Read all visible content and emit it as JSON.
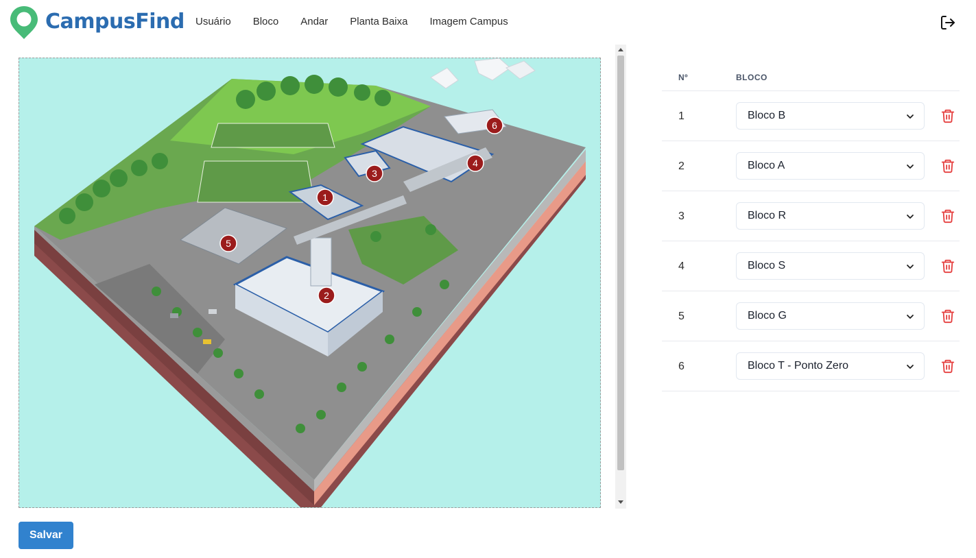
{
  "app": {
    "name": "CampusFind"
  },
  "nav": {
    "items": [
      {
        "label": "Usuário"
      },
      {
        "label": "Bloco"
      },
      {
        "label": "Andar"
      },
      {
        "label": "Planta Baixa"
      },
      {
        "label": "Imagem Campus"
      }
    ]
  },
  "map": {
    "markers": [
      "1",
      "2",
      "3",
      "4",
      "5",
      "6"
    ]
  },
  "actions": {
    "save_label": "Salvar"
  },
  "table": {
    "headers": {
      "num": "Nº",
      "bloco": "BLOCO"
    },
    "rows": [
      {
        "num": "1",
        "bloco": "Bloco B"
      },
      {
        "num": "2",
        "bloco": "Bloco A"
      },
      {
        "num": "3",
        "bloco": "Bloco R"
      },
      {
        "num": "4",
        "bloco": "Bloco S"
      },
      {
        "num": "5",
        "bloco": "Bloco G"
      },
      {
        "num": "6",
        "bloco": "Bloco T - Ponto Zero"
      }
    ]
  },
  "colors": {
    "brand": "#2b6cb0",
    "logo_green": "#48bb78",
    "primary_button": "#3182ce",
    "delete_icon": "#e53e3e",
    "marker": "#9b1c1c",
    "map_background": "#b5f0ea"
  },
  "icons": {
    "logo": "map-pin-icon",
    "logout": "logout-icon",
    "row_delete": "trash-icon",
    "select_arrow": "chevron-down-icon"
  }
}
